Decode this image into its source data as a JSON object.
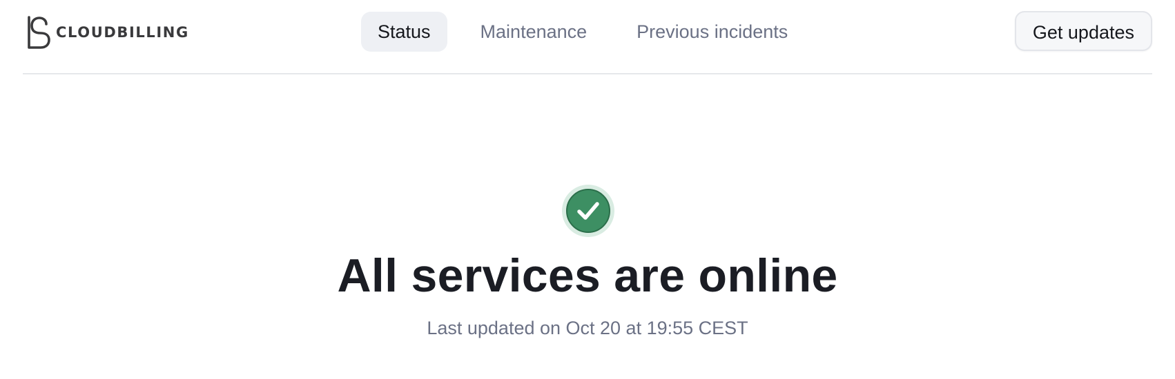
{
  "brand": {
    "name": "CLOUDBILLING",
    "logo_icon": "cloudbilling-logo-icon",
    "text_color": "#3a3a3c"
  },
  "nav": {
    "items": [
      {
        "label": "Status",
        "active": true
      },
      {
        "label": "Maintenance",
        "active": false
      },
      {
        "label": "Previous incidents",
        "active": false
      }
    ]
  },
  "header_actions": {
    "get_updates_label": "Get updates"
  },
  "status": {
    "icon": "check-circle-icon",
    "color": "#3d8f63",
    "headline": "All services are online",
    "last_updated": "Last updated on Oct 20 at 19:55 CEST"
  }
}
